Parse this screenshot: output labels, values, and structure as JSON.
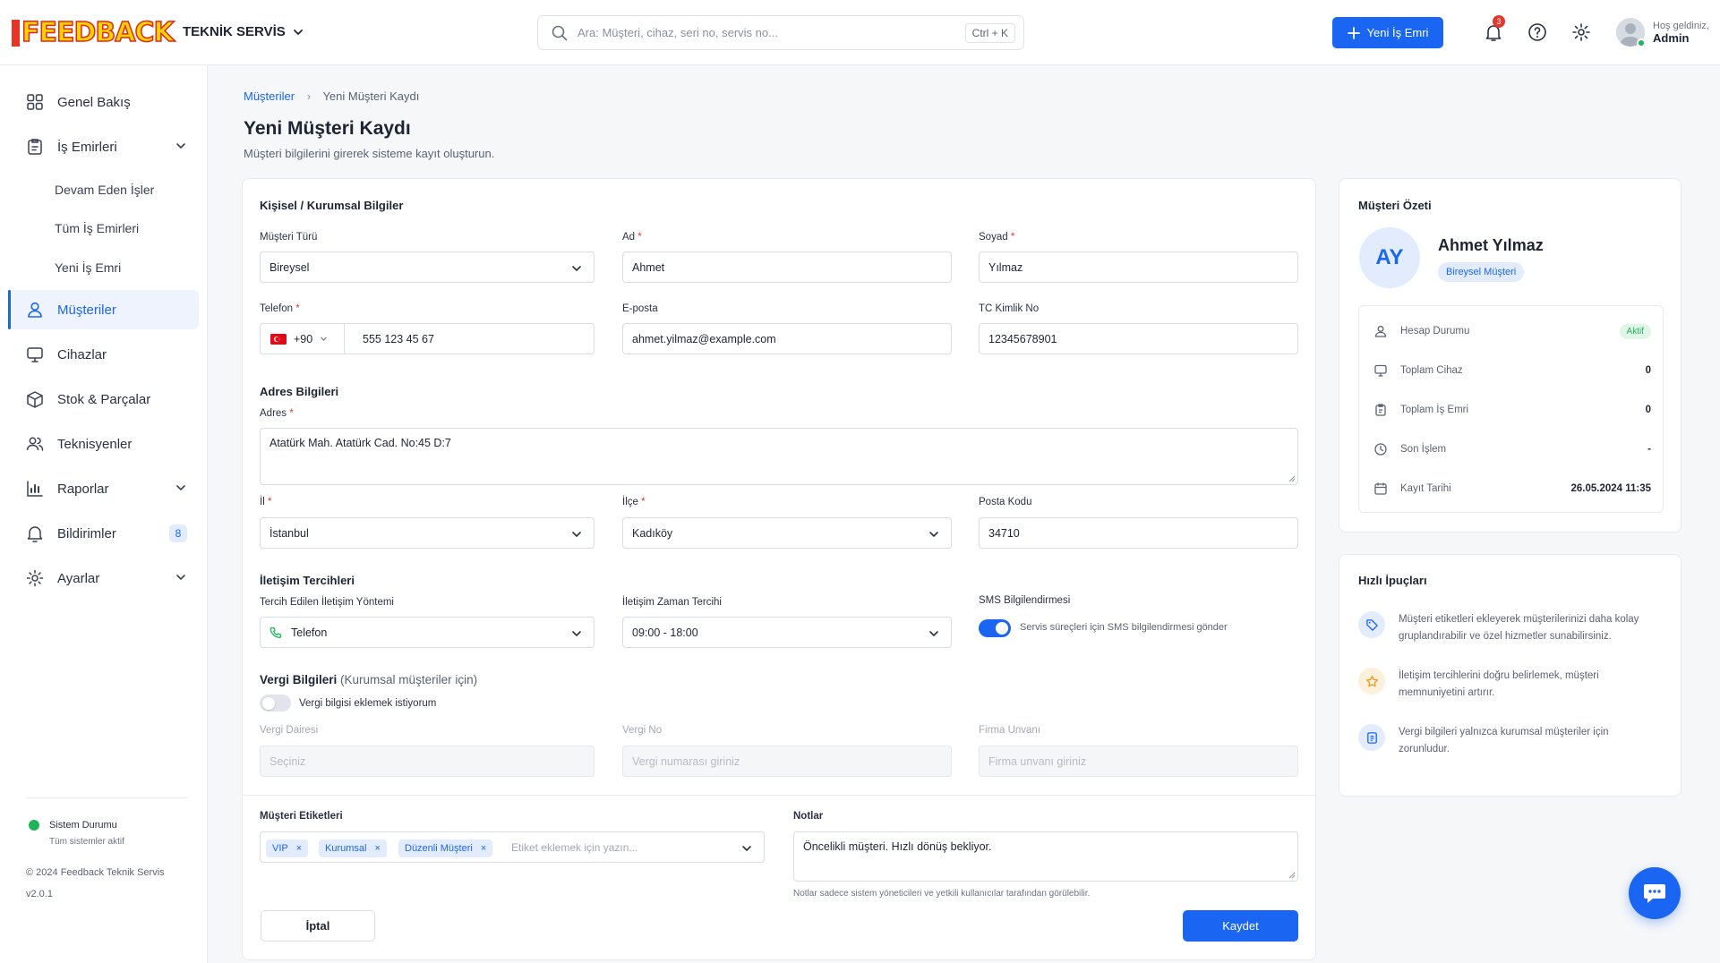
{
  "brand": {
    "logo_text": "FEEDBACK",
    "department": "TEKNİK SERVİS"
  },
  "header": {
    "search_placeholder": "Ara: Müşteri, cihaz, seri no, servis no...",
    "search_shortcut": "Ctrl + K",
    "new_order_label": "Yeni İş Emri",
    "notification_count": "3",
    "greeting": "Hoş geldiniz,",
    "user": "Admin"
  },
  "sidebar": {
    "items": [
      {
        "label": "Genel Bakış",
        "icon": "grid-icon"
      },
      {
        "label": "İş Emirleri",
        "icon": "clipboard-icon"
      },
      {
        "label": "Müşteriler",
        "icon": "user-icon"
      },
      {
        "label": "Cihazlar",
        "icon": "monitor-icon"
      },
      {
        "label": "Stok & Parçalar",
        "icon": "box-icon"
      },
      {
        "label": "Teknisyenler",
        "icon": "users-icon"
      },
      {
        "label": "Raporlar",
        "icon": "chart-icon"
      },
      {
        "label": "Bildirimler",
        "icon": "bell-icon"
      },
      {
        "label": "Ayarlar",
        "icon": "gear-icon"
      }
    ],
    "sub_items": [
      "Devam Eden İşler",
      "Tüm İş Emirleri",
      "Yeni İş Emri"
    ],
    "notification_badge": "8",
    "system_status": "Sistem Durumu",
    "system_status_detail": "Tüm sistemler aktif",
    "copyright": "© 2024 Feedback Teknik Servis",
    "version": "v2.0.1"
  },
  "breadcrumb": {
    "parent": "Müşteriler",
    "current": "Yeni Müşteri Kaydı"
  },
  "page": {
    "title": "Yeni Müşteri Kaydı",
    "subtitle": "Müşteri bilgilerini girerek sisteme kayıt oluşturun."
  },
  "form": {
    "personal": {
      "title": "Kişisel / Kurumsal Bilgiler",
      "customer_type_label": "Müşteri Türü",
      "customer_type_value": "Bireysel",
      "name_label": "Ad",
      "name_value": "Ahmet",
      "surname_label": "Soyad",
      "surname_value": "Yılmaz",
      "phone_label": "Telefon",
      "phone_code": "+90",
      "phone_value": "555 123 45 67",
      "email_label": "E-posta",
      "email_value": "ahmet.yilmaz@example.com",
      "tc_label": "TC Kimlik No",
      "tc_value": "12345678901"
    },
    "address": {
      "title": "Adres Bilgileri",
      "address_label": "Adres",
      "address_value": "Atatürk Mah. Atatürk Cad. No:45 D:7",
      "city_label": "İl",
      "city_value": "İstanbul",
      "district_label": "İlçe",
      "district_value": "Kadıköy",
      "postal_label": "Posta Kodu",
      "postal_value": "34710"
    },
    "contact": {
      "title": "İletişim Tercihleri",
      "method_label": "Tercih Edilen İletişim Yöntemi",
      "method_value": "Telefon",
      "time_label": "İletişim Zaman Tercihi",
      "time_value": "09:00 - 18:00",
      "sms_label": "SMS Bilgilendirmesi",
      "sms_text": "Servis süreçleri için SMS bilgilendirmesi gönder",
      "sms_on": true
    },
    "tax": {
      "title": "Vergi Bilgileri",
      "title_note": "(Kurumsal müşteriler için)",
      "toggle_text": "Vergi bilgisi eklemek istiyorum",
      "toggle_on": false,
      "office_label": "Vergi Dairesi",
      "office_placeholder": "Seçiniz",
      "no_label": "Vergi No",
      "no_placeholder": "Vergi numarası giriniz",
      "company_label": "Firma Unvanı",
      "company_placeholder": "Firma unvanı giriniz"
    },
    "tags": {
      "label": "Müşteri Etiketleri",
      "items": [
        "VIP",
        "Kurumsal",
        "Düzenli Müşteri"
      ],
      "placeholder": "Etiket eklemek için yazın..."
    },
    "notes": {
      "label": "Notlar",
      "value": "Öncelikli müşteri. Hızlı dönüş bekliyor.",
      "hint": "Notlar sadece sistem yöneticileri ve yetkili kullanıcılar tarafından görülebilir."
    },
    "cancel_label": "İptal",
    "save_label": "Kaydet"
  },
  "summary": {
    "title": "Müşteri Özeti",
    "initials": "AY",
    "name": "Ahmet Yılmaz",
    "type_badge": "Bireysel Müşteri",
    "rows": [
      {
        "label": "Hesap Durumu",
        "value": "Aktif",
        "icon": "user-icon"
      },
      {
        "label": "Toplam Cihaz",
        "value": "0",
        "icon": "monitor-icon"
      },
      {
        "label": "Toplam İş Emri",
        "value": "0",
        "icon": "clipboard-icon"
      },
      {
        "label": "Son İşlem",
        "value": "-",
        "icon": "clock-icon"
      },
      {
        "label": "Kayıt Tarihi",
        "value": "26.05.2024 11:35",
        "icon": "calendar-icon"
      }
    ]
  },
  "tips": {
    "title": "Hızlı İpuçları",
    "items": [
      {
        "line1": "Müşteri etiketleri ekleyerek müşterilerinizi daha kolay",
        "line2": "gruplandırabilir ve özel hizmetler sunabilirsiniz.",
        "icon": "tag-icon"
      },
      {
        "line1": "İletişim tercihlerini doğru belirlemek, müşteri",
        "line2": "memnuniyetini artırır.",
        "icon": "star-icon"
      },
      {
        "line1": "Vergi bilgileri yalnızca kurumsal müşteriler için",
        "line2": "zorunludur.",
        "icon": "document-icon"
      }
    ]
  },
  "colors": {
    "accent": "#1a66f2",
    "success": "#21b35a",
    "danger": "#e5372b"
  }
}
